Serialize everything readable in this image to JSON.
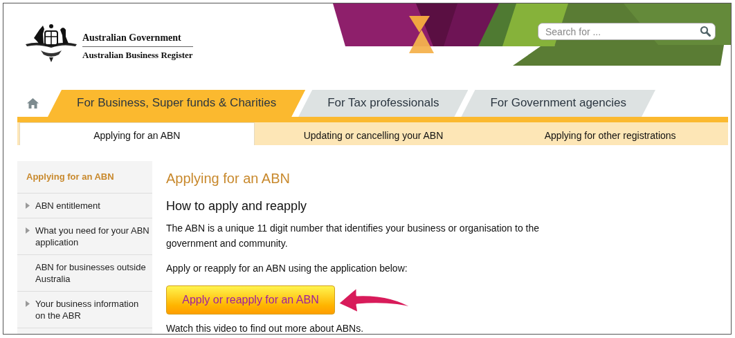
{
  "header": {
    "title": "Australian Government",
    "subtitle": "Australian Business Register",
    "search": {
      "placeholder": "Search for ..."
    }
  },
  "main_tabs": [
    {
      "label": "For Business, Super funds & Charities",
      "selected": true
    },
    {
      "label": "For Tax professionals",
      "selected": false
    },
    {
      "label": "For Government agencies",
      "selected": false
    }
  ],
  "sub_tabs": [
    {
      "label": "Applying for an ABN",
      "selected": true
    },
    {
      "label": "Updating or cancelling your ABN",
      "selected": false
    },
    {
      "label": "Applying for other registrations",
      "selected": false
    }
  ],
  "sidebar": {
    "title": "Applying for an ABN",
    "items": [
      {
        "label": "ABN entitlement",
        "expandable": true
      },
      {
        "label": "What you need for your ABN application",
        "expandable": true
      },
      {
        "label": "ABN for businesses outside Australia",
        "expandable": false
      },
      {
        "label": "Your business information on the ABR",
        "expandable": true
      }
    ]
  },
  "content": {
    "title": "Applying for an ABN",
    "heading": "How to apply and reapply",
    "paragraphs": [
      "The ABN is a unique 11 digit number that identifies your business or organisation to the government and community.",
      "Apply or reapply for an ABN using the application below:"
    ],
    "button": "Apply or reapply for an ABN",
    "footer_text": "Watch this video to find out more about ABNs."
  }
}
